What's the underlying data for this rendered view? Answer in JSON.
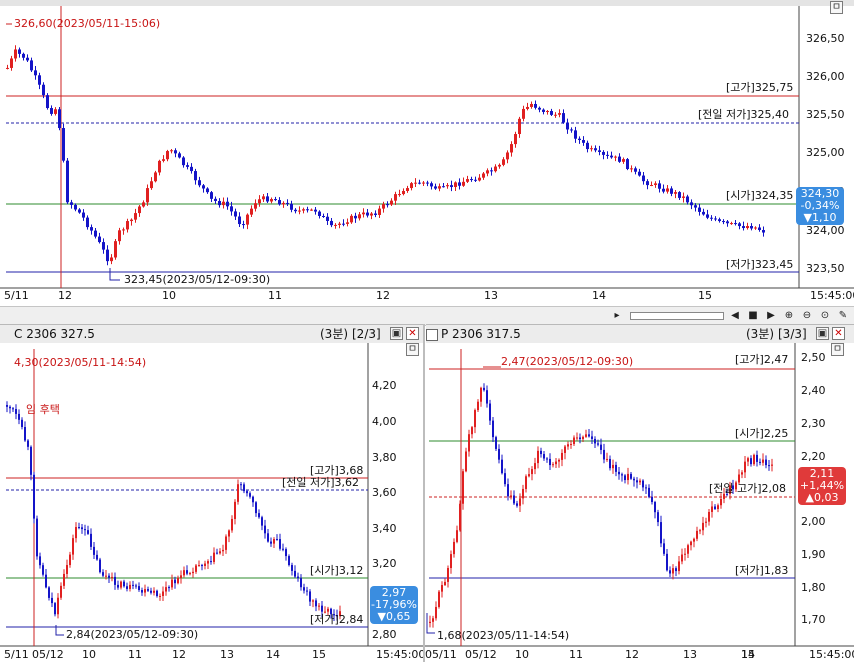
{
  "top": {
    "max_label": "326,60(2023/05/11-15:06)",
    "min_label": "323,45(2023/05/12-09:30)",
    "high_label": "[고가]325,75",
    "prev_low_label": "[전일 저가]325,40",
    "open_label": "[시가]324,35",
    "low_label": "[저가]323,45",
    "y_ticks": [
      "326,50",
      "326,00",
      "325,50",
      "325,00",
      "324,50",
      "324,00",
      "323,50"
    ],
    "x_ticks": [
      "5/11",
      "12",
      "10",
      "11",
      "12",
      "13",
      "14",
      "15",
      "15:45:00"
    ],
    "badge": [
      "324,30",
      "-0,34%",
      "▼1,10"
    ]
  },
  "call": {
    "title": "C 2306 327.5",
    "period": "(3분)",
    "page": "[2/3]",
    "max_label": "4,30(2023/05/11-14:54)",
    "min_label": "2,84(2023/05/12-09:30)",
    "annotation": "임 후택",
    "high_label": "[고가]3,68",
    "prev_low_label": "[전일 저가]3,62",
    "open_label": "[시가]3,12",
    "low_label": "[저가]2,84",
    "y_ticks": [
      "4,20",
      "4,00",
      "3,80",
      "3,60",
      "3,40",
      "3,20",
      "3,00",
      "2,80"
    ],
    "x_ticks": [
      "5/11",
      "05/12",
      "10",
      "11",
      "12",
      "13",
      "14",
      "15",
      "15:45:00"
    ],
    "badge": [
      "2,97",
      "-17,96%",
      "▼0,65"
    ]
  },
  "put": {
    "title": "P 2306 317.5",
    "period": "(3분)",
    "page": "[3/3]",
    "max_label": "2,47(2023/05/12-09:30)",
    "min_label": "1,68(2023/05/11-14:54)",
    "high_label": "[고가]2,47",
    "open_label": "[시가]2,25",
    "prev_high_label": "[전일 고가]2,08",
    "low_label": "[저가]1,83",
    "y_ticks": [
      "2,50",
      "2,40",
      "2,30",
      "2,20",
      "2,10",
      "2,00",
      "1,90",
      "1,80",
      "1,70"
    ],
    "x_ticks": [
      "05/11",
      "05/12",
      "10",
      "11",
      "12",
      "13",
      "14",
      "15",
      "15:45:00"
    ],
    "badge": [
      "2,11",
      "+1,44%",
      "▲0,03"
    ]
  },
  "colors": {
    "up": "#e02020",
    "down": "#1414c8",
    "high_line": "#cc2222",
    "open_line": "#2e8b2e",
    "low_line": "#2222aa",
    "badge_down": "#3a8de0",
    "badge_up": "#e03a3a"
  }
}
